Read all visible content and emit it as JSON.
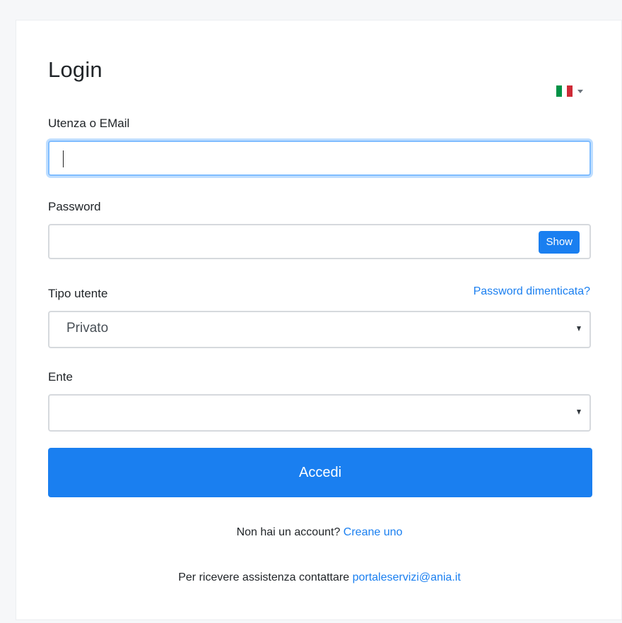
{
  "login": {
    "title": "Login",
    "language": {
      "flag_icon": "italy-flag-icon",
      "colors": [
        "#009246",
        "#ffffff",
        "#ce2b37"
      ]
    },
    "username": {
      "label": "Utenza o EMail",
      "value": "",
      "placeholder": ""
    },
    "password": {
      "label": "Password",
      "value": "",
      "show_label": "Show",
      "forgot_label": "Password dimenticata?"
    },
    "user_type": {
      "label": "Tipo utente",
      "selected": "Privato"
    },
    "entity": {
      "label": "Ente",
      "selected": ""
    },
    "submit_label": "Accedi",
    "register": {
      "prompt": "Non hai un account?",
      "link": "Creane uno"
    },
    "support": {
      "text": "Per ricevere assistenza contattare",
      "email": "portaleservizi@ania.it"
    }
  },
  "colors": {
    "accent": "#1a7ff0",
    "focus_border": "#80bdff"
  }
}
